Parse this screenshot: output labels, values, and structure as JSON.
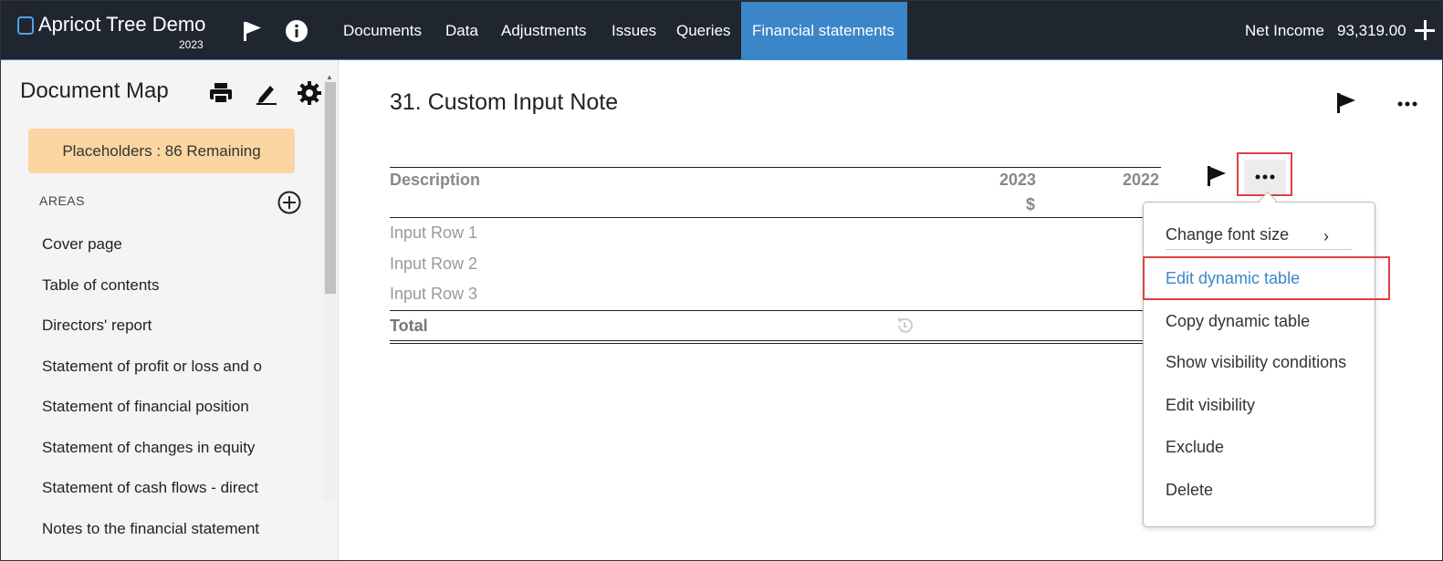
{
  "app": {
    "title": "Apricot Tree Demo",
    "year": "2023"
  },
  "nav": {
    "items": [
      "Documents",
      "Data",
      "Adjustments",
      "Issues",
      "Queries",
      "Financial statements"
    ],
    "active": "Financial statements"
  },
  "net_income": {
    "label": "Net Income",
    "value": "93,319.00"
  },
  "sidebar": {
    "title": "Document Map",
    "placeholder": "Placeholders : 86 Remaining",
    "areas_label": "AREAS",
    "items": [
      "Cover page",
      "Table of contents",
      "Directors' report",
      "Statement of profit or loss and o",
      "Statement of financial position",
      "Statement of changes in equity",
      "Statement of cash flows - direct",
      "Notes to the financial statement"
    ]
  },
  "note": {
    "title": "31. Custom Input Note",
    "table": {
      "header": {
        "description": "Description",
        "col1": "2023",
        "col2": "2022",
        "unit": "$"
      },
      "rows": [
        "Input Row 1",
        "Input Row 2",
        "Input Row 3"
      ],
      "total": "Total"
    }
  },
  "context_menu": {
    "items": [
      "Change font size",
      "Edit dynamic table",
      "Copy dynamic table",
      "Show visibility conditions",
      "Edit visibility",
      "Exclude",
      "Delete"
    ],
    "highlighted": "Edit dynamic table"
  },
  "colors": {
    "topbar": "#1f2630",
    "accent": "#3b86c8",
    "placeholder_bg": "#fbd6a2",
    "highlight": "#e04040"
  },
  "icons": [
    "flag-icon",
    "info-icon",
    "print-icon",
    "edit-icon",
    "gear-icon",
    "add-circle-icon",
    "more-icon",
    "undo-icon",
    "chevron-right-icon"
  ]
}
